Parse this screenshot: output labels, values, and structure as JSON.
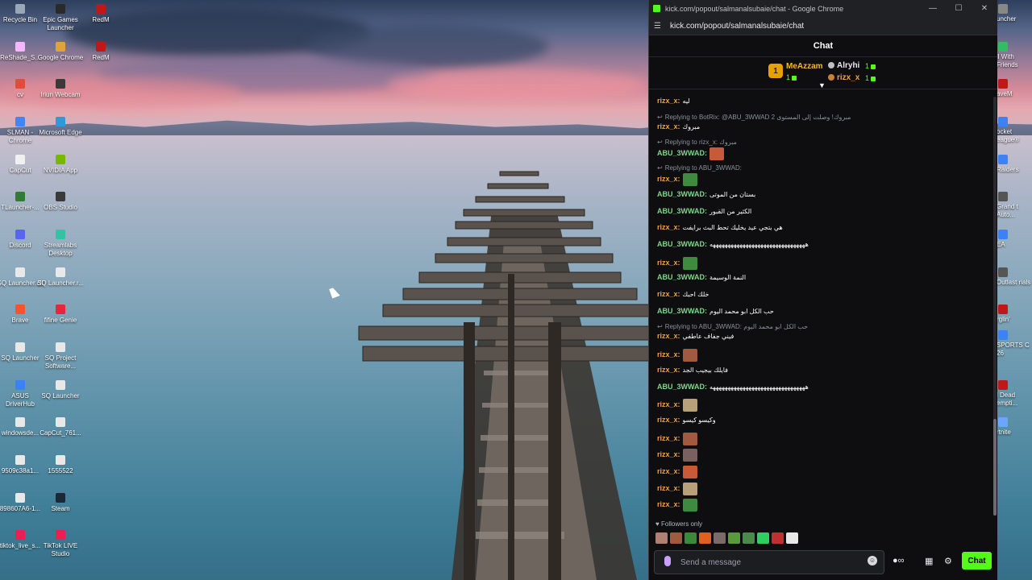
{
  "desktop": {
    "icons": [
      {
        "label": "Recycle Bin",
        "color": "#9aa7b7"
      },
      {
        "label": "Epic Games Launcher",
        "color": "#2a2a2a"
      },
      {
        "label": "RedM",
        "color": "#c01818"
      },
      {
        "label": "ReShade_S...",
        "color": "#f5b6ff"
      },
      {
        "label": "Google Chrome",
        "color": "#e0a33a"
      },
      {
        "label": "RedM",
        "color": "#c01818"
      },
      {
        "label": "cv",
        "color": "#e24c3b"
      },
      {
        "label": "Iriun Webcam",
        "color": "#3a3a3a"
      },
      {
        "label": "SLMAN - Chrome",
        "color": "#4285f4"
      },
      {
        "label": "Microsoft Edge",
        "color": "#2f9ad8"
      },
      {
        "label": "CapCut",
        "color": "#f0f0f0"
      },
      {
        "label": "NVIDIA App",
        "color": "#76b900"
      },
      {
        "label": "TLauncher-...",
        "color": "#2e7d32"
      },
      {
        "label": "OBS Studio",
        "color": "#3a3a3a"
      },
      {
        "label": "Discord",
        "color": "#5865f2"
      },
      {
        "label": "Streamlabs Desktop",
        "color": "#31c3a2"
      },
      {
        "label": "SQ Launcher.dll",
        "color": "#e8e8e8"
      },
      {
        "label": "SQ Launcher.r...",
        "color": "#e8e8e8"
      },
      {
        "label": "Brave",
        "color": "#fb542b"
      },
      {
        "label": "fifine Genie",
        "color": "#e8253f"
      },
      {
        "label": "SQ Launcher",
        "color": "#e8e8e8"
      },
      {
        "label": "SQ Project Software...",
        "color": "#e8e8e8"
      },
      {
        "label": "ASUS DriverHub",
        "color": "#3b82f6"
      },
      {
        "label": "SQ Launcher",
        "color": "#e8e8e8"
      },
      {
        "label": "windowsde...",
        "color": "#e8e8e8"
      },
      {
        "label": "CapCut_761...",
        "color": "#e8e8e8"
      },
      {
        "label": "9509c38a1...",
        "color": "#e8e8e8"
      },
      {
        "label": "1555522",
        "color": "#e8e8e8"
      },
      {
        "label": "898607A6-1...",
        "color": "#e8e8e8"
      },
      {
        "label": "Steam",
        "color": "#1b2838"
      },
      {
        "label": "tiktok_live_s...",
        "color": "#ee1d52"
      },
      {
        "label": "TikTok LIVE Studio",
        "color": "#ee1d52"
      }
    ],
    "edge_icons": [
      {
        "label": "uncher",
        "color": "#888"
      },
      {
        "label": "ll With Friends",
        "color": "#3b6"
      },
      {
        "label": "aveM",
        "color": "#c01818"
      },
      {
        "label": "ocket eague®",
        "color": "#3b82f6"
      },
      {
        "label": "Raiders",
        "color": "#3b82f6"
      },
      {
        "label": "Grand t Auto...",
        "color": "#555"
      },
      {
        "label": "EA",
        "color": "#3b82f6"
      },
      {
        "label": "Outlast rials",
        "color": "#555"
      },
      {
        "label": "rglin'",
        "color": "#c01818"
      },
      {
        "label": "SPORTS C 26",
        "color": "#3b82f6"
      },
      {
        "label": "l Dead empti...",
        "color": "#c01818"
      },
      {
        "label": "rtnite",
        "color": "#6aa6ff"
      }
    ]
  },
  "window": {
    "title": "kick.com/popout/salmanalsubaie/chat - Google Chrome",
    "url": "kick.com/popout/salmanalsubaie/chat",
    "controls": {
      "minimize": "—",
      "maximize": "☐",
      "close": "✕"
    }
  },
  "chat": {
    "header": "Chat",
    "leaderboard": {
      "rank": "1",
      "first": {
        "name": "MeAzzam",
        "count": "1"
      },
      "second": {
        "name": "Alryhi",
        "count": "1"
      },
      "third": {
        "name": "rizx_x",
        "count": "1"
      }
    },
    "messages": [
      {
        "user": "rizx_x:",
        "color": "#f0a040",
        "text": "ليه"
      },
      {
        "reply": "Replying to BotRix: @ABU_3WWAD 2 مبروك! وصلت إلى المستوى"
      },
      {
        "user": "rizx_x:",
        "color": "#f0a040",
        "text": "مبروك"
      },
      {
        "reply": "Replying to rizx_x: مبروك"
      },
      {
        "user": "ABU_3WWAD:",
        "color": "#7fd68a",
        "text": ""
      },
      {
        "reply": "Replying to ABU_3WWAD:"
      },
      {
        "user": "rizx_x:",
        "color": "#f0a040",
        "text": ""
      },
      {
        "user": "ABU_3WWAD:",
        "color": "#7fd68a",
        "text": "بستان من الموتى"
      },
      {
        "user": "ABU_3WWAD:",
        "color": "#7fd68a",
        "text": "الكثير من القبور"
      },
      {
        "user": "rizx_x:",
        "color": "#f0a040",
        "text": "هي بتجي عيد يخليك تحط البث برايفت"
      },
      {
        "user": "ABU_3WWAD:",
        "color": "#7fd68a",
        "text": "ههههههههههههههههههههههههههههههههه"
      },
      {
        "user": "rizx_x:",
        "color": "#f0a040",
        "text": ""
      },
      {
        "user": "ABU_3WWAD:",
        "color": "#7fd68a",
        "text": "النمة الوسيمة"
      },
      {
        "user": "rizx_x:",
        "color": "#f0a040",
        "text": "خلك احبك"
      },
      {
        "user": "ABU_3WWAD:",
        "color": "#7fd68a",
        "text": "حب الكل ابو محمد اليوم"
      },
      {
        "reply": "Replying to ABU_3WWAD: حب الكل ابو محمد اليوم"
      },
      {
        "user": "rizx_x:",
        "color": "#f0a040",
        "text": "فيني جفاف عاطفي"
      },
      {
        "user": "rizx_x:",
        "color": "#f0a040",
        "text": ""
      },
      {
        "user": "rizx_x:",
        "color": "#f0a040",
        "text": "فايلك بيجيب الجد"
      },
      {
        "user": "ABU_3WWAD:",
        "color": "#7fd68a",
        "text": "ههههههههههههههههههههههههههههههههه"
      },
      {
        "user": "rizx_x:",
        "color": "#f0a040",
        "text": ""
      },
      {
        "user": "rizx_x:",
        "color": "#f0a040",
        "text": "وكيسو كيسو"
      },
      {
        "user": "rizx_x:",
        "color": "#f0a040",
        "text": ""
      },
      {
        "user": "rizx_x:",
        "color": "#f0a040",
        "text": ""
      },
      {
        "user": "rizx_x:",
        "color": "#f0a040",
        "text": ""
      },
      {
        "user": "rizx_x:",
        "color": "#f0a040",
        "text": ""
      },
      {
        "user": "rizx_x:",
        "color": "#f0a040",
        "text": ""
      }
    ],
    "followers_only": "Followers only",
    "input_placeholder": "Send a message",
    "send_label": "Chat",
    "colors": {
      "accent": "#53fc18",
      "bg": "#0e0e10"
    }
  }
}
